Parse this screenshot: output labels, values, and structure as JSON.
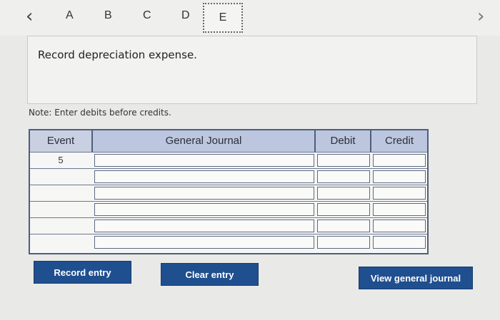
{
  "nav": {
    "prev": "‹",
    "next": "›",
    "tabs": [
      {
        "label": "A"
      },
      {
        "label": "B"
      },
      {
        "label": "C"
      },
      {
        "label": "D"
      },
      {
        "label": "E"
      }
    ],
    "active_tab": "E"
  },
  "instruction": "Record depreciation expense.",
  "note": "Note: Enter debits before credits.",
  "journal": {
    "headers": {
      "event": "Event",
      "general_journal": "General Journal",
      "debit": "Debit",
      "credit": "Credit"
    },
    "rows": [
      {
        "event": "5",
        "account": "",
        "debit": "",
        "credit": ""
      },
      {
        "event": "",
        "account": "",
        "debit": "",
        "credit": ""
      },
      {
        "event": "",
        "account": "",
        "debit": "",
        "credit": ""
      },
      {
        "event": "",
        "account": "",
        "debit": "",
        "credit": ""
      },
      {
        "event": "",
        "account": "",
        "debit": "",
        "credit": ""
      },
      {
        "event": "",
        "account": "",
        "debit": "",
        "credit": ""
      }
    ]
  },
  "buttons": {
    "record_entry": "Record entry",
    "clear_entry": "Clear entry",
    "view_general_journal": "View general journal"
  },
  "colors": {
    "header_bg": "#bcc6de",
    "button_bg": "#1f4f8f",
    "table_border": "#4f5f7a"
  }
}
